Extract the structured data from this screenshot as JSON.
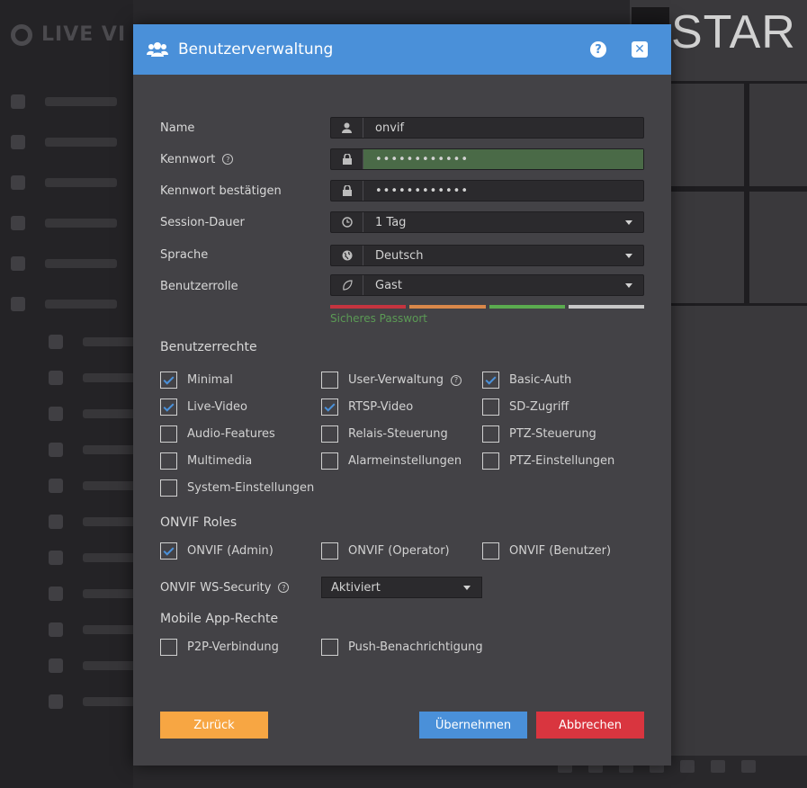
{
  "colors": {
    "header": "#4a90d9",
    "modal_bg": "#434246",
    "back": "#f7a643",
    "apply": "#4a90d9",
    "cancel": "#d9353f",
    "strength": [
      "#c5343f",
      "#d9884a",
      "#5bab4f",
      "#c8c8c8"
    ],
    "strength_text": "#5b9a55"
  },
  "modal": {
    "title": "Benutzerverwaltung",
    "icon": "users-icon",
    "help_label": "?",
    "close_label": "✕"
  },
  "form": {
    "name_label": "Name",
    "name_value": "onvif",
    "password_label": "Kennwort",
    "password_value": "••••••••••••",
    "confirm_label": "Kennwort bestätigen",
    "confirm_value": "••••••••••••",
    "session_label": "Session-Dauer",
    "session_value": "1 Tag",
    "language_label": "Sprache",
    "language_value": "Deutsch",
    "role_label": "Benutzerrolle",
    "role_value": "Gast",
    "strength_text": "Sicheres Passwort"
  },
  "rights": {
    "title": "Benutzerrechte",
    "items": [
      {
        "label": "Minimal",
        "checked": true
      },
      {
        "label": "User-Verwaltung",
        "checked": false
      },
      {
        "label": "Basic-Auth",
        "checked": true
      },
      {
        "label": "Live-Video",
        "checked": true
      },
      {
        "label": "RTSP-Video",
        "checked": true
      },
      {
        "label": "SD-Zugriff",
        "checked": false
      },
      {
        "label": "Audio-Features",
        "checked": false
      },
      {
        "label": "Relais-Steuerung",
        "checked": false
      },
      {
        "label": "PTZ-Steuerung",
        "checked": false
      },
      {
        "label": "Multimedia",
        "checked": false
      },
      {
        "label": "Alarmeinstellungen",
        "checked": false
      },
      {
        "label": "PTZ-Einstellungen",
        "checked": false
      },
      {
        "label": "System-Einstellungen",
        "checked": false
      }
    ]
  },
  "onvif": {
    "title": "ONVIF Roles",
    "roles": [
      {
        "label": "ONVIF (Admin)",
        "checked": true
      },
      {
        "label": "ONVIF (Operator)",
        "checked": false
      },
      {
        "label": "ONVIF (Benutzer)",
        "checked": false
      }
    ],
    "ws_security_label": "ONVIF WS-Security",
    "ws_security_value": "Aktiviert"
  },
  "mobile": {
    "title": "Mobile App-Rechte",
    "items": [
      {
        "label": "P2P-Verbindung",
        "checked": false
      },
      {
        "label": "Push-Benachrichtigung",
        "checked": false
      }
    ]
  },
  "buttons": {
    "back": "Zurück",
    "apply": "Übernehmen",
    "cancel": "Abbrechen"
  },
  "background": {
    "app_name": "LIVE VI",
    "brand": "STAR"
  }
}
